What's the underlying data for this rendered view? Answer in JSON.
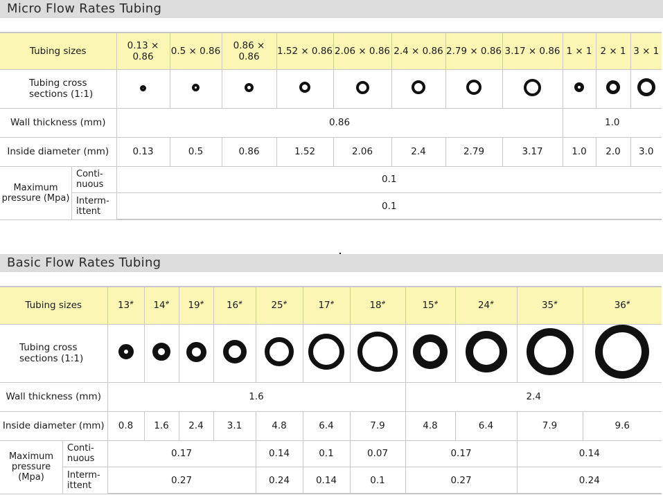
{
  "micro": {
    "title": "Micro Flow Rates Tubing",
    "labels": {
      "sizes": "Tubing sizes",
      "cross": "Tubing cross sections (1:1)",
      "wall": "Wall thickness (mm)",
      "inside": "Inside diameter (mm)",
      "pressure": "Maximum pressure (Mpa)",
      "continuous": "Conti- nuous",
      "intermittent": "Interm- ittent"
    },
    "sizes": [
      "0.13 × 0.86",
      "0.5 × 0.86",
      "0.86 × 0.86",
      "1.52 × 0.86",
      "2.06 × 0.86",
      "2.4 × 0.86",
      "2.79 × 0.86",
      "3.17 × 0.86",
      "1 × 1",
      "2 × 1",
      "3 × 1"
    ],
    "wall_thickness": [
      "0.86",
      "1.0"
    ],
    "inside_diameter": [
      "0.13",
      "0.5",
      "0.86",
      "1.52",
      "2.06",
      "2.4",
      "2.79",
      "3.17",
      "1.0",
      "2.0",
      "3.0"
    ],
    "continuous": "0.1",
    "intermittent": "0.1"
  },
  "basic": {
    "title": "Basic Flow Rates Tubing",
    "labels": {
      "sizes": "Tubing sizes",
      "cross": "Tubing cross sections (1:1)",
      "wall": "Wall thickness (mm)",
      "inside": "Inside diameter (mm)",
      "pressure": "Maximum pressure (Mpa)",
      "continuous": "Conti- nuous",
      "intermittent": "Interm- ittent"
    },
    "sizes": [
      "13",
      "14",
      "19",
      "16",
      "25",
      "17",
      "18",
      "15",
      "24",
      "35",
      "36"
    ],
    "size_mark": "#",
    "wall_thickness": [
      "1.6",
      "2.4"
    ],
    "inside_diameter": [
      "0.8",
      "1.6",
      "2.4",
      "3.1",
      "4.8",
      "6.4",
      "7.9",
      "4.8",
      "6.4",
      "7.9",
      "9.6"
    ],
    "continuous": [
      "0.17",
      "0.14",
      "0.1",
      "0.07",
      "0.17",
      "0.14"
    ],
    "intermittent": [
      "0.27",
      "0.24",
      "0.14",
      "0.1",
      "0.27",
      "0.24"
    ]
  },
  "colors": {
    "header_bg": "#fbf6b4",
    "title_bar": "#dcdcdc",
    "ring": "#111111",
    "border": "#c8c8c8"
  }
}
